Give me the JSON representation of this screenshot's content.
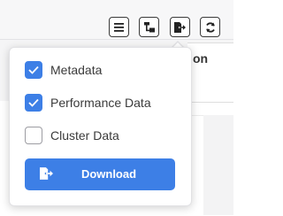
{
  "toolbar": {
    "buttons": [
      {
        "icon": "list-icon"
      },
      {
        "icon": "tree-icon"
      },
      {
        "icon": "export-icon"
      },
      {
        "icon": "refresh-icon"
      }
    ]
  },
  "table": {
    "column_header_partial": "on"
  },
  "download_menu": {
    "options": [
      {
        "label": "Metadata",
        "checked": true
      },
      {
        "label": "Performance Data",
        "checked": true
      },
      {
        "label": "Cluster Data",
        "checked": false
      }
    ],
    "download_label": "Download",
    "download_icon": "export-icon"
  },
  "colors": {
    "accent": "#3d7fe6",
    "text": "#3a3a3a",
    "border": "#9c9ca2"
  }
}
